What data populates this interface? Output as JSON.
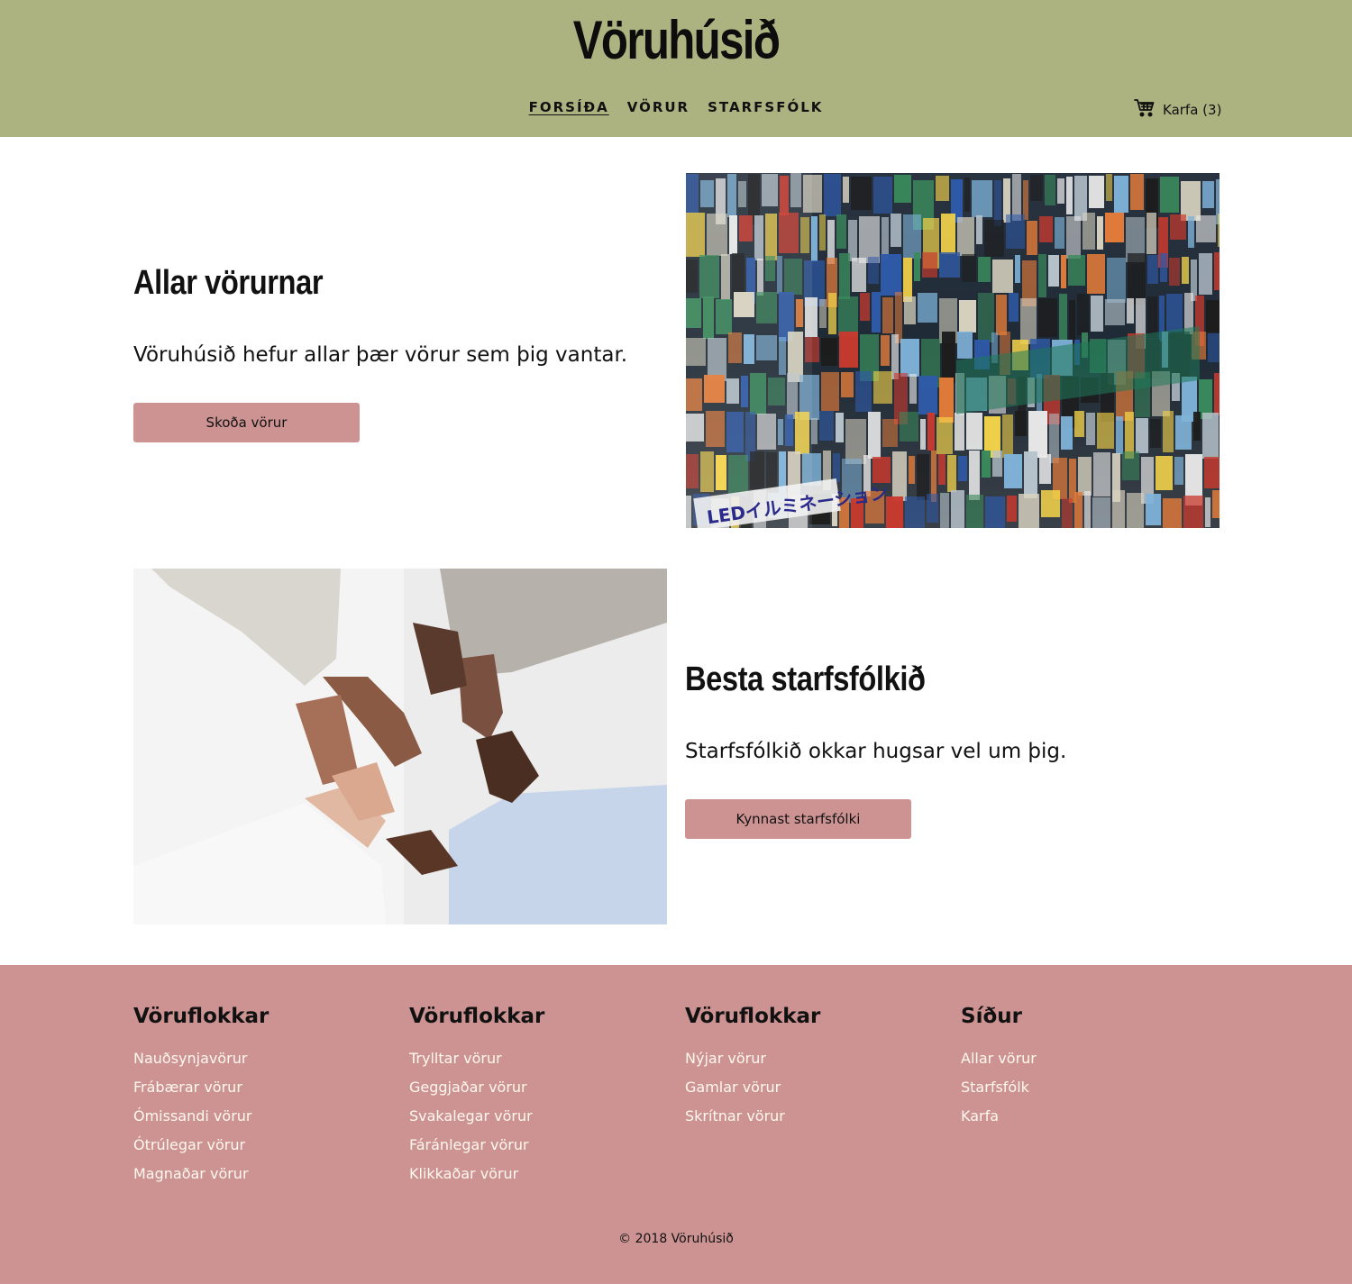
{
  "header": {
    "logo": "Vöruhúsið",
    "nav": [
      "FORSÍÐA",
      "VÖRUR",
      "STARFSFÓLK"
    ],
    "cart_label": "Karfa (3)",
    "background": "#adb380"
  },
  "hero1": {
    "title": "Allar vörurnar",
    "text": "Vöruhúsið hefur allar þær vörur sem þig vantar.",
    "button": "Skoða vörur",
    "image_label": "LEDイルミネーション"
  },
  "hero2": {
    "title": "Besta starfsfólkið",
    "text": "Starfsfólkið okkar hugsar vel um þig.",
    "button": "Kynnast starfsfólki"
  },
  "footer": {
    "background": "#cd9392",
    "columns": [
      {
        "title": "Vöruflokkar",
        "items": [
          "Nauðsynjavörur",
          "Frábærar vörur",
          "Ómissandi vörur",
          "Ótrúlegar vörur",
          "Magnaðar vörur"
        ]
      },
      {
        "title": "Vöruflokkar",
        "items": [
          "Trylltar vörur",
          "Geggjaðar vörur",
          "Svakalegar vörur",
          "Fáránlegar vörur",
          "Klikkaðar vörur"
        ]
      },
      {
        "title": "Vöruflokkar",
        "items": [
          "Nýjar vörur",
          "Gamlar vörur",
          "Skrítnar vörur"
        ]
      },
      {
        "title": "Síður",
        "items": [
          "Allar vörur",
          "Starfsfólk",
          "Karfa"
        ]
      }
    ],
    "copyright": "© 2018 Vöruhúsið"
  },
  "colors": {
    "accent": "#cd9392",
    "header": "#adb380",
    "link": "#fff8ee"
  }
}
